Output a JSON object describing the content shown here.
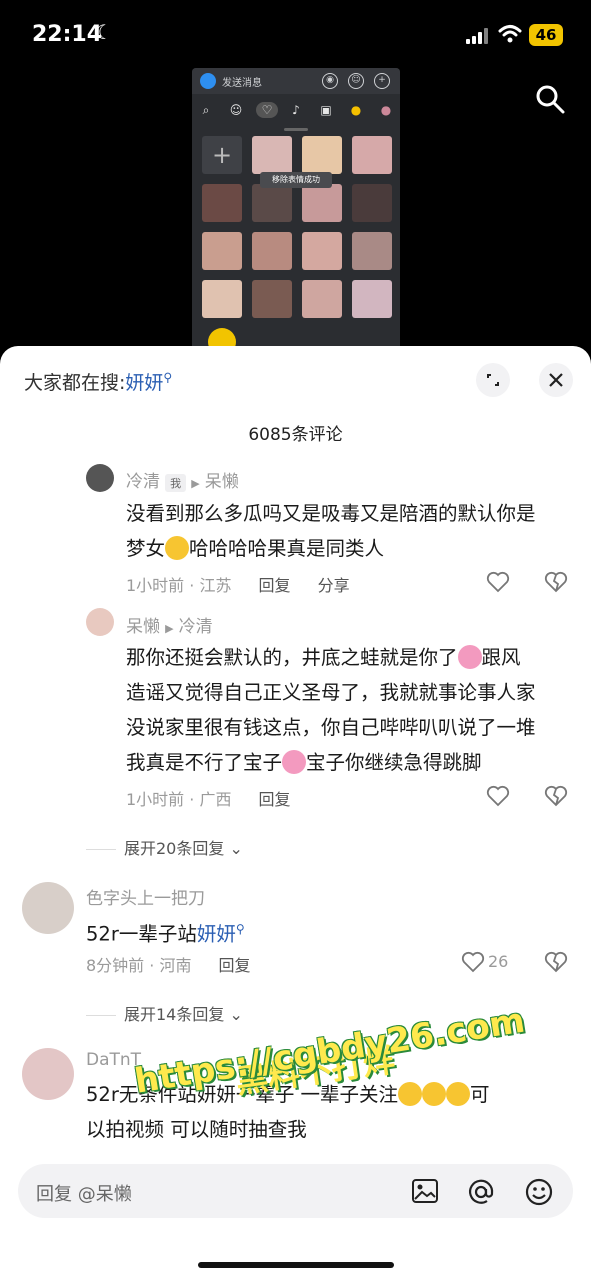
{
  "status": {
    "time": "22:14",
    "battery": "46"
  },
  "preview": {
    "send_placeholder": "发送消息",
    "toast": "移除表情成功"
  },
  "sheet": {
    "search_hint_prefix": "大家都在搜:",
    "search_hint_keyword": "妍妍",
    "comment_count": "6085条评论"
  },
  "comments": [
    {
      "user": "冷清",
      "me_badge": "我",
      "reply_to": "呆懒",
      "text_line1": "没看到那么多瓜吗又是吸毒又是陪酒的默认你是",
      "text_line2a": "梦女",
      "text_line2b": "哈哈哈哈果真是同类人",
      "meta": "1小时前 · 江苏",
      "reply": "回复",
      "share": "分享"
    },
    {
      "user": "呆懒",
      "reply_to": "冷清",
      "text_line1a": "那你还挺会默认的，井底之蛙就是你了",
      "text_line1b": "跟风",
      "text_line2": "造谣又觉得自己正义圣母了，我就就事论事人家",
      "text_line3": "没说家里很有钱这点，你自己哔哔叭叭说了一堆",
      "text_line4a": "我真是不行了宝子",
      "text_line4b": "宝子你继续急得跳脚",
      "meta": "1小时前 · 广西",
      "reply": "回复"
    },
    {
      "user": "色字头上一把刀",
      "text_a": "52r一辈子站",
      "text_kw": "妍妍",
      "meta": "8分钟前 · 河南",
      "reply": "回复",
      "likes": "26"
    },
    {
      "user": "DaTnT",
      "text_line1": "52r无条件站妍妍一辈子 一辈子关注",
      "text_line1b": "可",
      "text_line2": "以拍视频 可以随时抽查我"
    }
  ],
  "expand1": "展开20条回复",
  "expand2": "展开14条回复",
  "input": {
    "placeholder": "回复 @呆懒"
  },
  "watermark": {
    "line1": "黑料不打烊",
    "line2": "https://cgbdy26.com"
  },
  "colors": {
    "link": "#2b5fb3",
    "muted": "#9a9a9a",
    "battery": "#f2c400"
  },
  "icons": [
    "moon-icon",
    "signal-icon",
    "wifi-icon",
    "search-icon",
    "fullscreen-icon",
    "close-icon",
    "heart-icon",
    "broken-heart-icon",
    "image-icon",
    "at-icon",
    "emoji-icon"
  ]
}
